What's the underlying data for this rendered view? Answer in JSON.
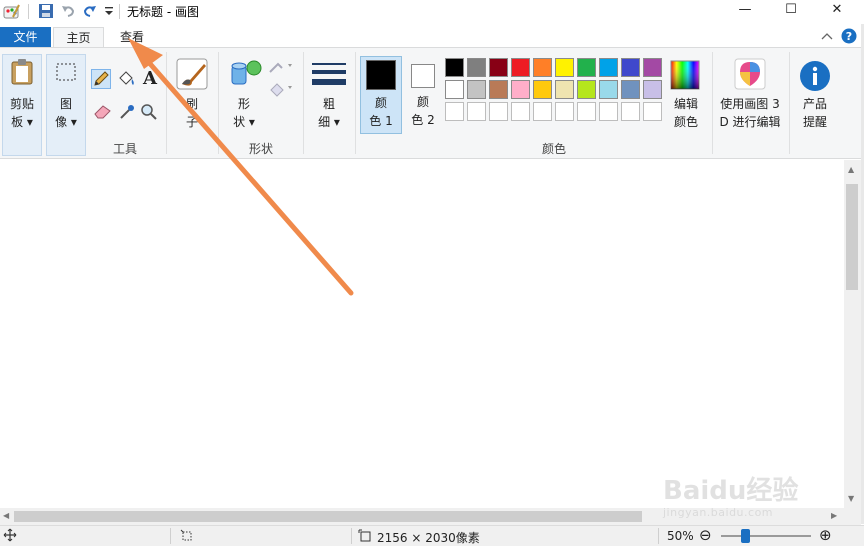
{
  "window": {
    "title": "无标题 - 画图",
    "controls": {
      "minimize": "—",
      "maximize": "☐",
      "close": "✕"
    }
  },
  "tabs": {
    "file": "文件",
    "home": "主页",
    "view": "查看"
  },
  "ribbon": {
    "clipboard": {
      "line1": "剪贴",
      "line2": "板"
    },
    "image": {
      "line1": "图",
      "line2": "像"
    },
    "tools": {
      "label": "工具",
      "text_glyph": "A"
    },
    "brushes": {
      "line1": "刷",
      "line2": "子"
    },
    "shapes": {
      "line1": "形",
      "line2": "状",
      "label": "形状"
    },
    "size": {
      "line1": "粗",
      "line2": "细"
    },
    "color1": {
      "line1": "颜",
      "line2": "色 1",
      "value": "#000000"
    },
    "color2": {
      "line1": "颜",
      "line2": "色 2",
      "value": "#ffffff"
    },
    "colors_label": "颜色",
    "edit_colors": {
      "line1": "编辑",
      "line2": "颜色"
    },
    "paint3d": {
      "line1": "使用画图 3",
      "line2": "D 进行编辑"
    },
    "product": {
      "line1": "产品",
      "line2": "提醒"
    },
    "palette_row1": [
      "#000000",
      "#7f7f7f",
      "#880015",
      "#ed1c24",
      "#ff7f27",
      "#fff200",
      "#22b14c",
      "#00a2e8",
      "#3f48cc",
      "#a349a4"
    ],
    "palette_row2": [
      "#ffffff",
      "#c3c3c3",
      "#b97a57",
      "#ffaec9",
      "#ffc90e",
      "#efe4b0",
      "#b5e61d",
      "#99d9ea",
      "#7092be",
      "#c8bfe7"
    ]
  },
  "statusbar": {
    "canvas_size": "2156 × 2030像素",
    "zoom": "50%",
    "zoom_out": "⊖",
    "zoom_in": "⊕"
  },
  "watermark": {
    "text": "Baidu经验",
    "sub": "jingyan.baidu.com"
  }
}
